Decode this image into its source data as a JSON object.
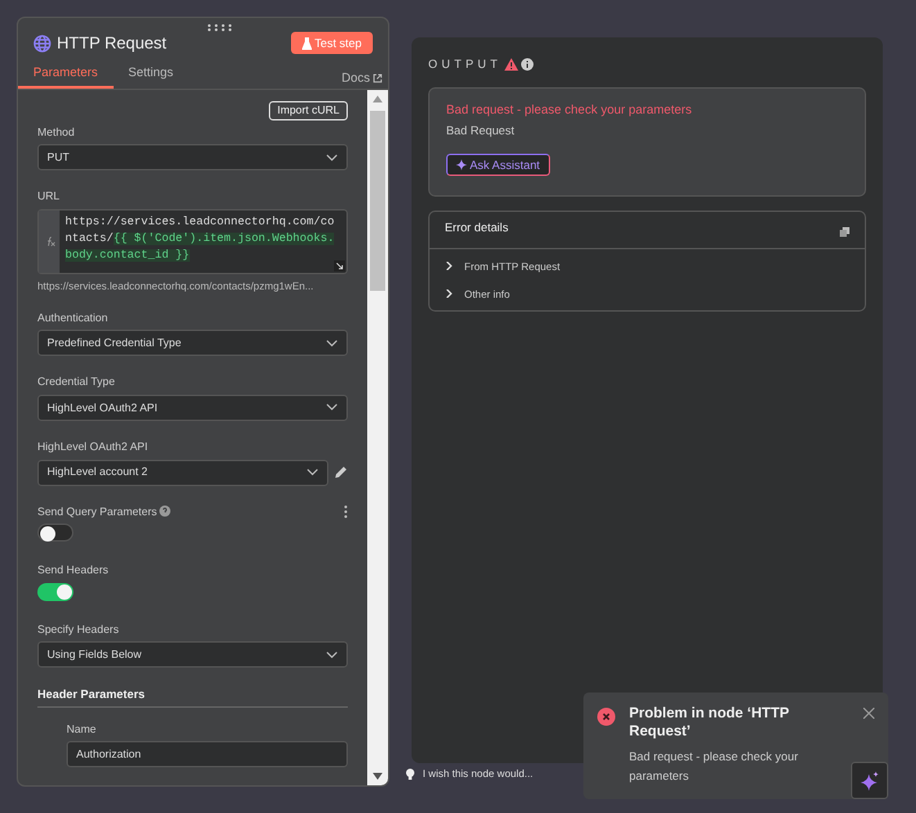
{
  "node": {
    "title": "HTTP Request",
    "test_button": "Test step",
    "docs": "Docs",
    "tabs": [
      {
        "label": "Parameters",
        "selected": true
      },
      {
        "label": "Settings",
        "selected": false
      }
    ]
  },
  "import_button": "Import cURL",
  "fields": [
    {
      "kind": "select",
      "label": "Method",
      "value": "PUT"
    },
    {
      "kind": "expression",
      "label": "URL",
      "plain": "https://services.leadconnectorhq.com/contacts/",
      "expression": "{{ $('Code').item.json.Webhooks.body.contact_id }}",
      "hint": "https://services.leadconnectorhq.com/contacts/pzmg1wEn..."
    },
    {
      "kind": "select",
      "label": "Authentication",
      "value": "Predefined Credential Type"
    },
    {
      "kind": "select",
      "label": "Credential Type",
      "value": "HighLevel OAuth2 API"
    },
    {
      "kind": "credential",
      "label": "HighLevel OAuth2 API",
      "value": "HighLevel account 2"
    },
    {
      "kind": "toggle",
      "label": "Send Query Parameters",
      "on": false,
      "help_icon": true,
      "options_menu": true
    },
    {
      "kind": "toggle",
      "label": "Send Headers",
      "on": true
    },
    {
      "kind": "select",
      "label": "Specify Headers",
      "value": "Using Fields Below"
    },
    {
      "kind": "section",
      "label": "Header Parameters"
    },
    {
      "kind": "text",
      "label": "Name",
      "value": "Authorization"
    }
  ],
  "output": {
    "label": "OUTPUT",
    "error_title": "Bad request - please check your parameters",
    "error_message": "Bad Request",
    "assistant_button": "Ask Assistant",
    "details": {
      "title": "Error details",
      "rows": [
        {
          "label": "From HTTP Request",
          "expanded": false
        },
        {
          "label": "Other info",
          "expanded": false
        }
      ]
    }
  },
  "feedback": "I wish this node would...",
  "toast": {
    "title": "Problem in node ‘HTTP Request’",
    "message": "Bad request - please check your parameters"
  }
}
